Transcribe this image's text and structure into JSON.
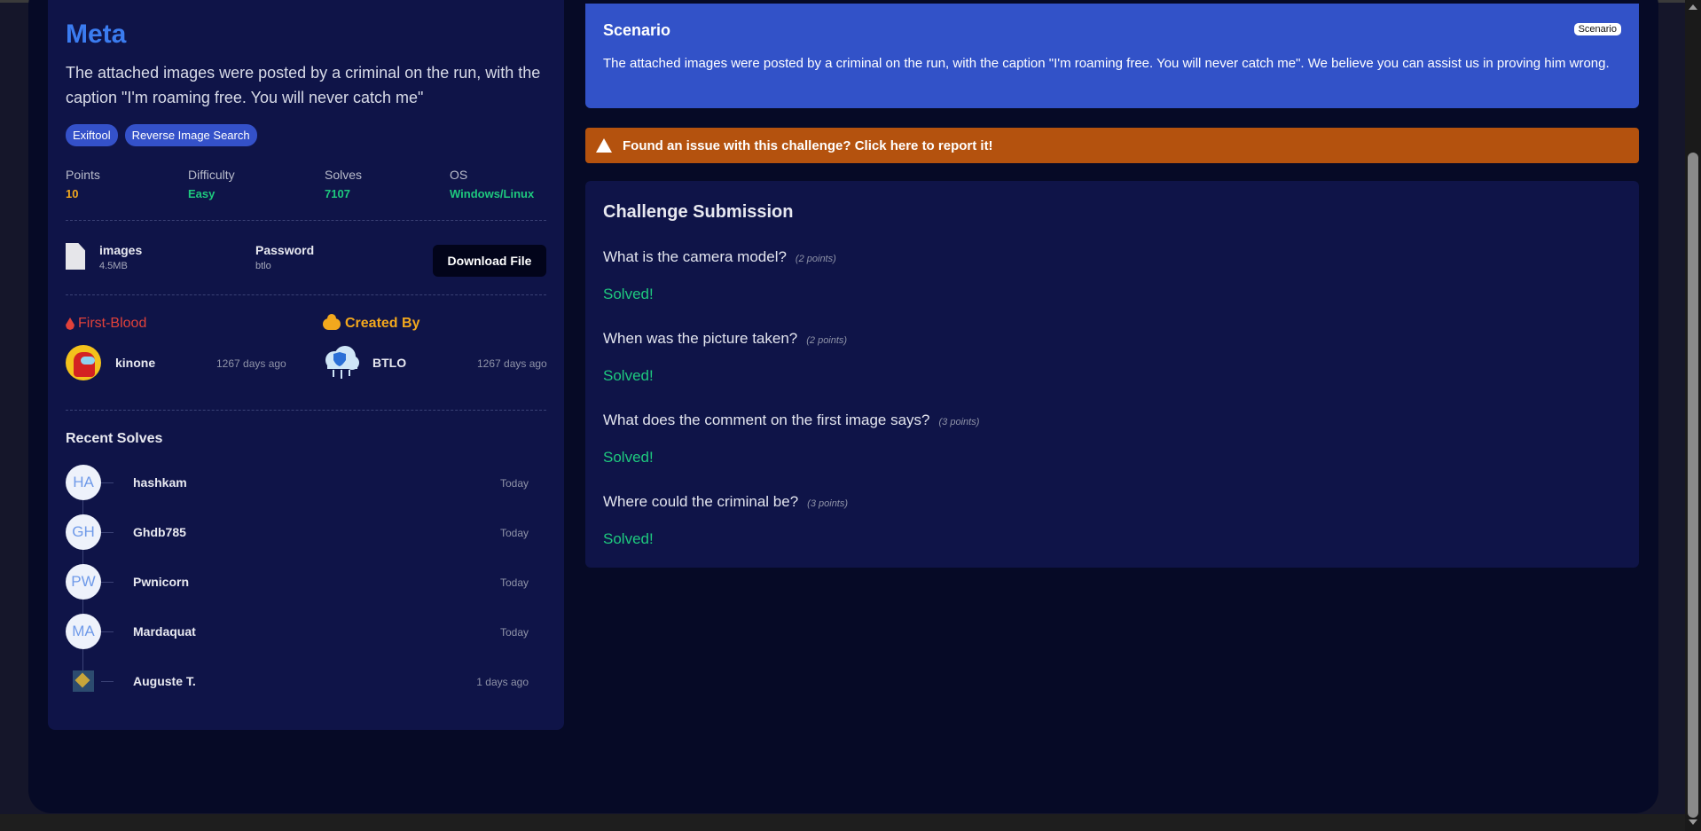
{
  "challenge": {
    "title": "Meta",
    "description": "The attached images were posted by a criminal on the run, with the caption \"I'm roaming free. You will never catch me\"",
    "tags": [
      "Exiftool",
      "Reverse Image Search"
    ],
    "stats": {
      "points_label": "Points",
      "points": "10",
      "difficulty_label": "Difficulty",
      "difficulty": "Easy",
      "solves_label": "Solves",
      "solves": "7107",
      "os_label": "OS",
      "os": "Windows/Linux"
    },
    "file": {
      "name": "images",
      "size": "4.5MB",
      "password_label": "Password",
      "password": "btlo",
      "download_label": "Download File"
    },
    "first_blood": {
      "heading": "First-Blood",
      "user": "kinone",
      "time": "1267 days ago"
    },
    "created_by": {
      "heading": "Created By",
      "user": "BTLO",
      "time": "1267 days ago"
    },
    "recent_solves": {
      "heading": "Recent Solves",
      "items": [
        {
          "initials": "HA",
          "name": "hashkam",
          "time": "Today"
        },
        {
          "initials": "GH",
          "name": "Ghdb785",
          "time": "Today"
        },
        {
          "initials": "PW",
          "name": "Pwnicorn",
          "time": "Today"
        },
        {
          "initials": "MA",
          "name": "Mardaquat",
          "time": "Today"
        },
        {
          "initials": "",
          "name": "Auguste T.",
          "time": "1 days ago"
        }
      ]
    }
  },
  "scenario": {
    "title": "Scenario",
    "badge": "Scenario",
    "text": "The attached images were posted by a criminal on the run, with the caption \"I'm roaming free. You will never catch me\". We believe you can assist us in proving him wrong."
  },
  "report": {
    "text": "Found an issue with this challenge? Click here to report it!"
  },
  "submission": {
    "title": "Challenge Submission",
    "questions": [
      {
        "text": "What is the camera model?",
        "points": "(2 points)",
        "status": "Solved!"
      },
      {
        "text": "When was the picture taken?",
        "points": "(2 points)",
        "status": "Solved!"
      },
      {
        "text": "What does the comment on the first image says?",
        "points": "(3 points)",
        "status": "Solved!"
      },
      {
        "text": "Where could the criminal be?",
        "points": "(3 points)",
        "status": "Solved!"
      }
    ]
  },
  "colors": {
    "accent": "#3b7cf0",
    "points": "#f2a81d",
    "easy": "#1ec97e",
    "first_blood": "#e0413a",
    "report": "#b4520e",
    "scenario": "#3252c8"
  }
}
